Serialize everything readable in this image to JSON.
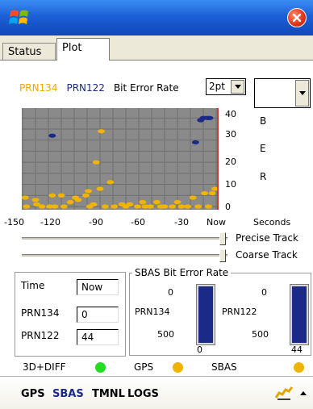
{
  "tabs": [
    {
      "label": "Status"
    },
    {
      "label": "Plot"
    }
  ],
  "legend": {
    "prn134": "PRN134",
    "prn122": "PRN122",
    "title": "Bit Error Rate"
  },
  "point_size_select": {
    "value": "2pt"
  },
  "ber_vertical": [
    "B",
    "E",
    "R"
  ],
  "chart_data": {
    "type": "scatter",
    "x_ticks": [
      "-150",
      "-120",
      "-90",
      "-60",
      "-30",
      "Now"
    ],
    "x_unit": "Seconds",
    "y_ticks": [
      "40",
      "30",
      "20",
      "10",
      "0"
    ],
    "xlim": [
      -150,
      0
    ],
    "ylim": [
      0,
      43
    ],
    "series": [
      {
        "name": "PRN134",
        "color": "#f0b400",
        "points": [
          [
            -148,
            4
          ],
          [
            -147,
            0
          ],
          [
            -140,
            3
          ],
          [
            -139,
            1
          ],
          [
            -135,
            0
          ],
          [
            -129,
            0
          ],
          [
            -127,
            5
          ],
          [
            -125,
            0
          ],
          [
            -120,
            5
          ],
          [
            -118,
            0
          ],
          [
            -113,
            2
          ],
          [
            -109,
            4
          ],
          [
            -107,
            3
          ],
          [
            -101,
            5
          ],
          [
            -99,
            7
          ],
          [
            -98,
            0
          ],
          [
            -95,
            1
          ],
          [
            -93,
            20
          ],
          [
            -90,
            8
          ],
          [
            -89,
            34
          ],
          [
            -86,
            0
          ],
          [
            -82,
            11
          ],
          [
            -79,
            0
          ],
          [
            -73,
            1
          ],
          [
            -70,
            0
          ],
          [
            -67,
            1
          ],
          [
            -61,
            0
          ],
          [
            -57,
            2
          ],
          [
            -55,
            0
          ],
          [
            -51,
            0
          ],
          [
            -46,
            2
          ],
          [
            -43,
            0
          ],
          [
            -40,
            0
          ],
          [
            -34,
            0
          ],
          [
            -30,
            2
          ],
          [
            -27,
            0
          ],
          [
            -22,
            0
          ],
          [
            -18,
            4
          ],
          [
            -14,
            0
          ],
          [
            -9,
            6
          ],
          [
            -6,
            0
          ],
          [
            -3,
            6
          ],
          [
            -1,
            8
          ]
        ]
      },
      {
        "name": "PRN122",
        "color": "#1a2a86",
        "points": [
          [
            -127,
            32
          ],
          [
            -16,
            29
          ],
          [
            -12,
            39
          ],
          [
            -10,
            40
          ],
          [
            -7,
            40
          ],
          [
            -5,
            40
          ]
        ]
      }
    ]
  },
  "sliders": [
    {
      "label": "Precise Track"
    },
    {
      "label": "Coarse Track"
    }
  ],
  "info_box": {
    "time_label": "Time",
    "time_value": "Now",
    "prn134_label": "PRN134",
    "prn134_value": "0",
    "prn122_label": "PRN122",
    "prn122_value": "44"
  },
  "sbas": {
    "title": "SBAS Bit Error Rate",
    "left": {
      "top": "0",
      "name": "PRN134",
      "bottom": "500",
      "value": "0"
    },
    "right": {
      "top": "0",
      "name": "PRN122",
      "bottom": "500",
      "value": "44"
    }
  },
  "status": {
    "mode": "3D+DIFF",
    "gps": "GPS",
    "sbas": "SBAS",
    "mode_color": "#22dd22",
    "gps_color": "#f0b400",
    "sbas_color": "#f0b400"
  },
  "bottom_bar": {
    "gps": "GPS",
    "sbas": "SBAS",
    "tmnl": "TMNL",
    "logs": "LOGS"
  }
}
